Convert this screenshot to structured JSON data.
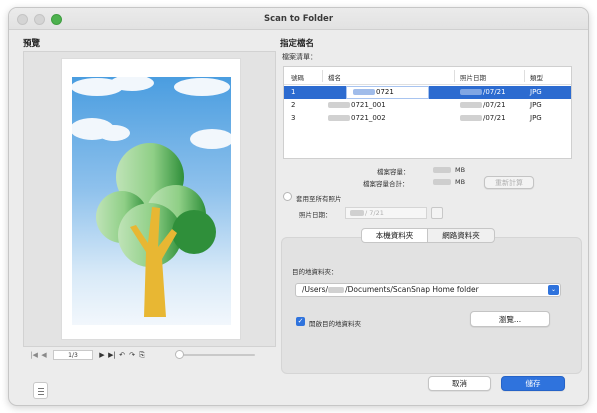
{
  "window": {
    "title": "Scan to Folder"
  },
  "preview": {
    "title": "預覽",
    "page_indicator": "1/3",
    "nav_icons": [
      "first-page-icon",
      "prev-page-icon",
      "next-page-icon",
      "last-page-icon",
      "rotate-left-icon",
      "rotate-right-icon",
      "fit-page-icon"
    ]
  },
  "file_name_section": {
    "title": "指定檔名",
    "list_label": "檔案清單：",
    "columns": [
      "號碼",
      "檔名",
      "照片日期",
      "類型"
    ],
    "rows": [
      {
        "number": "1",
        "name": "0721",
        "date": "/07/21",
        "type": "JPG",
        "selected": true
      },
      {
        "number": "2",
        "name": "0721_001",
        "date": "/07/21",
        "type": "JPG",
        "selected": false
      },
      {
        "number": "3",
        "name": "0721_002",
        "date": "/07/21",
        "type": "JPG",
        "selected": false
      }
    ],
    "file_size_label": "檔案容量：",
    "file_size_unit": "MB",
    "total_size_label": "檔案容量合計：",
    "total_size_unit": "MB",
    "recalc_button": "重新計算",
    "apply_all_label": "套用至所有照片",
    "photo_date_label": "照片日期：",
    "photo_date_value": "/  7/21"
  },
  "destination": {
    "tabs": [
      "本機資料夾",
      "網路資料夾"
    ],
    "active_tab": 0,
    "folder_label": "目的地資料夾：",
    "folder_path_prefix": "/Users/",
    "folder_path_suffix": "/Documents/ScanSnap Home folder",
    "open_folder_label": "開啟目的地資料夾",
    "open_folder_checked": true,
    "browse_button": "瀏覽..."
  },
  "footer": {
    "cancel_button": "取消",
    "save_button": "儲存"
  },
  "colors": {
    "accent": "#2f73dd",
    "selected_row": "#2c6bd0",
    "window_bg": "#ececec",
    "tree_green": "#3c9a3c",
    "trunk_yellow": "#e8b733"
  }
}
